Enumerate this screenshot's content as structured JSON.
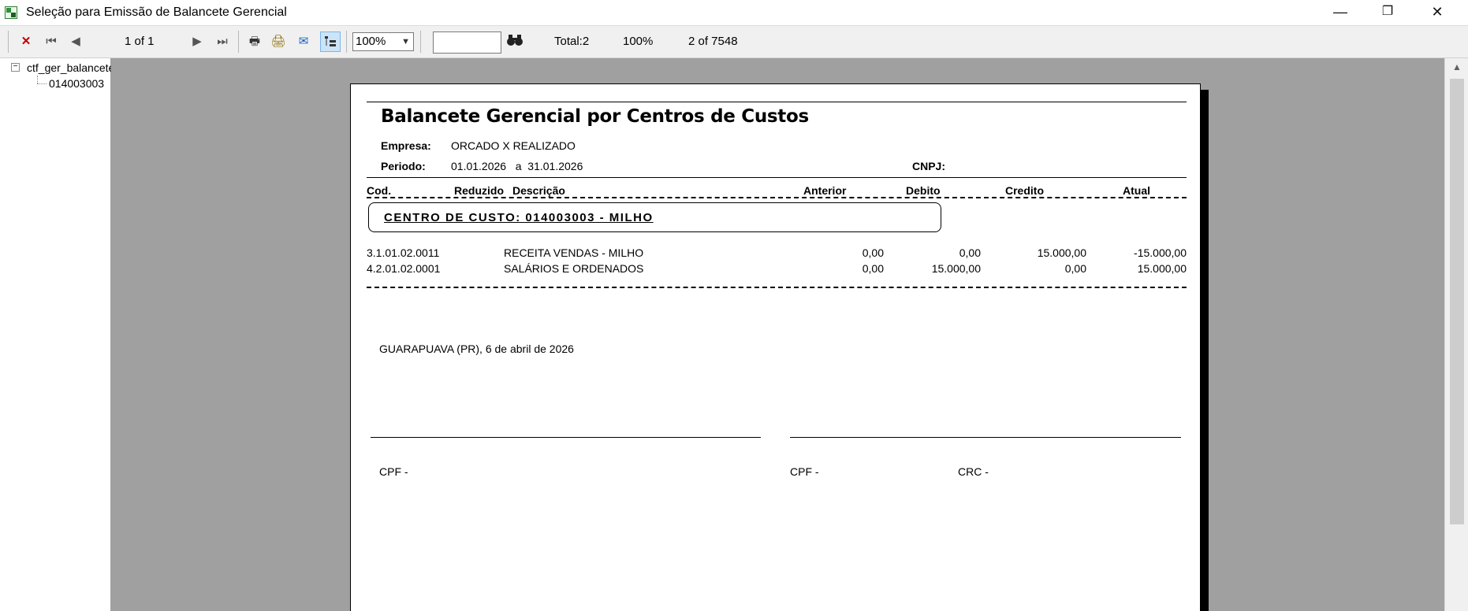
{
  "window": {
    "title": "Seleção para Emissão de Balancete Gerencial",
    "controls": {
      "minimize": "—",
      "restore": "❐",
      "close": "✕"
    }
  },
  "toolbar": {
    "page_indicator": "1 of 1",
    "zoom": "100%",
    "search_value": "",
    "total": "Total:2",
    "percent": "100%",
    "records": "2 of 7548"
  },
  "tree": {
    "root": "ctf_ger_balancete",
    "child": "014003003"
  },
  "report": {
    "title": "Balancete Gerencial por Centros de Custos",
    "empresa_label": "Empresa:",
    "empresa_value": "ORCADO X REALIZADO",
    "periodo_label": "Periodo:",
    "periodo_value": "01.01.2026   a  31.01.2026",
    "cnpj_label": "CNPJ:",
    "columns": {
      "cod": "Cod.",
      "reduzido": "Reduzido",
      "descricao": "Descrição",
      "anterior": "Anterior",
      "debito": "Debito",
      "credito": "Credito",
      "atual": "Atual"
    },
    "cost_center": "CENTRO DE CUSTO: 014003003 - MILHO",
    "rows": [
      {
        "cod": "3.1.01.02.0011",
        "descricao": "RECEITA VENDAS - MILHO",
        "anterior": "0,00",
        "debito": "0,00",
        "credito": "15.000,00",
        "atual": "-15.000,00"
      },
      {
        "cod": "4.2.01.02.0001",
        "descricao": "SALÁRIOS E ORDENADOS",
        "anterior": "0,00",
        "debito": "15.000,00",
        "credito": "0,00",
        "atual": "15.000,00"
      }
    ],
    "place_date": "GUARAPUAVA (PR), 6 de abril de 2026",
    "sig_cpf_left": "CPF -",
    "sig_cpf_right": "CPF -",
    "sig_crc": "CRC -"
  }
}
